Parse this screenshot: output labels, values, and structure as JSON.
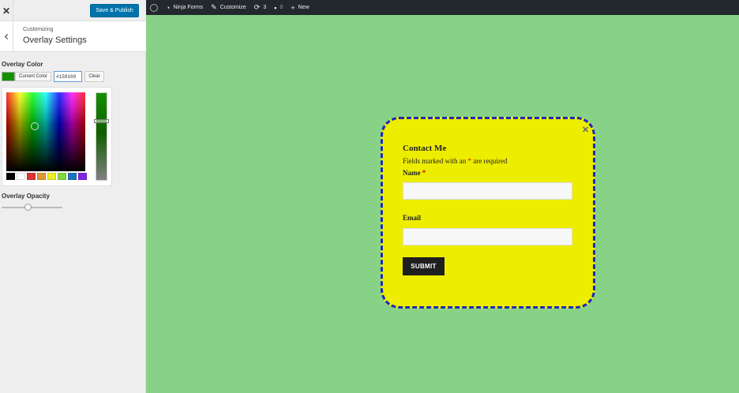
{
  "customizer": {
    "close_icon": "close-icon",
    "publish_label": "Save & Publish",
    "breadcrumb": "Customizing",
    "section_title": "Overlay Settings",
    "overlay_color": {
      "label": "Overlay Color",
      "current_color_label": "Current Color",
      "hex_value": "#159100",
      "clear_label": "Clear",
      "swatch_color": "#159100",
      "palette": [
        "#000000",
        "#ffffff",
        "#dd3333",
        "#dd9933",
        "#eeee22",
        "#81d742",
        "#1e73be",
        "#8224e3"
      ]
    },
    "overlay_opacity": {
      "label": "Overlay Opacity",
      "value_fraction": 0.42
    }
  },
  "adminbar": {
    "site_name": "Ninja Forms",
    "customize_label": "Customize",
    "updates_count": "3",
    "comments_count": "0",
    "new_label": "New"
  },
  "popup": {
    "form_title": "Contact Me",
    "required_note_pre": "Fields marked with an ",
    "required_star": "*",
    "required_note_post": " are required",
    "name_label": "Name ",
    "email_label": "Email",
    "submit_label": "SUBMIT",
    "background_color": "#eded00",
    "border_color": "#1b2bb8"
  }
}
